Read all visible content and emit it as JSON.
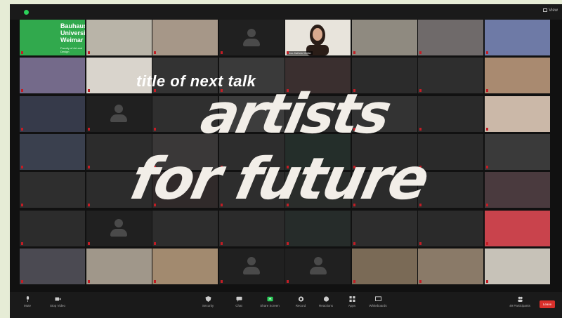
{
  "window": {
    "view_label": "View"
  },
  "logo_tile": {
    "lines": [
      "Bauhaus-",
      "Universität",
      "Weimar"
    ],
    "subtitle": "Faculty of Art and Design"
  },
  "speaker_tile": {
    "name": "Ann-Kathrin Müller"
  },
  "overlay": {
    "subtitle": "title of next talk",
    "line1": "artists",
    "line2": "for future"
  },
  "toolbar": {
    "mute": "Mute",
    "stop_video": "Stop Video",
    "security": "Security",
    "chat": "Chat",
    "share_screen": "Share Screen",
    "record": "Record",
    "reactions": "Reactions",
    "apps": "Apps",
    "whiteboards": "Whiteboards",
    "participants": "Participants",
    "participant_count": "49",
    "leave": "Leave"
  },
  "colors": {
    "accent": "#31a94d",
    "leave": "#d9302b",
    "share": "#2bd15a"
  },
  "tiles": [
    {
      "c": "logo"
    },
    {
      "c": "#b9b4a8"
    },
    {
      "c": "#a69788"
    },
    {
      "c": "avatar"
    },
    {
      "c": "speaker"
    },
    {
      "c": "#8f8a80"
    },
    {
      "c": "#6f6a6a"
    },
    {
      "c": "#6e7aa6"
    },
    {
      "c": "#746a8a"
    },
    {
      "c": "#d9d4cc"
    },
    {
      "c": "#333"
    },
    {
      "c": "#3a3a3a"
    },
    {
      "c": "#3a2f2f"
    },
    {
      "c": "#2b2b2b"
    },
    {
      "c": "#2e2e2e"
    },
    {
      "c": "#a98a70"
    },
    {
      "c": "#363a4a"
    },
    {
      "c": "avatar"
    },
    {
      "c": "#2f2f2f"
    },
    {
      "c": "#3d3d3d"
    },
    {
      "c": "#2c2c2c"
    },
    {
      "c": "#333"
    },
    {
      "c": "#2a2a2a"
    },
    {
      "c": "#cbb8a8"
    },
    {
      "c": "#3a404e"
    },
    {
      "c": "#2c2c2c"
    },
    {
      "c": "#3a3838"
    },
    {
      "c": "#2d2d2d"
    },
    {
      "c": "#242e2a"
    },
    {
      "c": "#2b2b2b"
    },
    {
      "c": "#2a2a2a"
    },
    {
      "c": "#3a3a3a"
    },
    {
      "c": "#2e2e2e"
    },
    {
      "c": "#2c2c2c"
    },
    {
      "c": "#302a2a"
    },
    {
      "c": "#2d2d2d"
    },
    {
      "c": "#2a2d2b"
    },
    {
      "c": "#2b2b2b"
    },
    {
      "c": "#2a2a2a"
    },
    {
      "c": "#4a3a3e"
    },
    {
      "c": "#2c2c2c"
    },
    {
      "c": "avatar"
    },
    {
      "c": "#2d2d2d"
    },
    {
      "c": "#2b2b2b"
    },
    {
      "c": "#262c2a"
    },
    {
      "c": "#2d2d2d"
    },
    {
      "c": "#2a2a2a"
    },
    {
      "c": "#c9434c"
    },
    {
      "c": "#4b4a52"
    },
    {
      "c": "#a0978a"
    },
    {
      "c": "#a28a6f"
    },
    {
      "c": "avatar"
    },
    {
      "c": "avatar"
    },
    {
      "c": "#7a6a56"
    },
    {
      "c": "#8a7a68"
    },
    {
      "c": "#c7c2b8"
    }
  ]
}
